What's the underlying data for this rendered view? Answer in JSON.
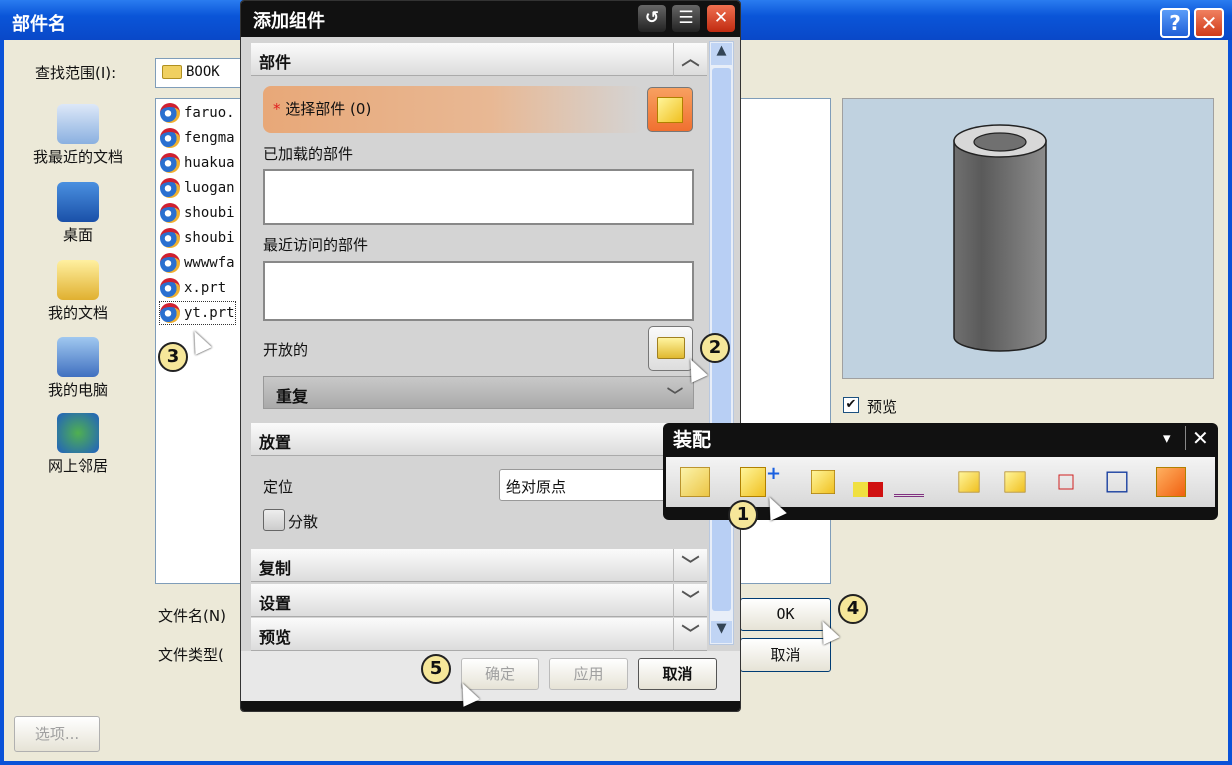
{
  "file_dialog": {
    "title": "部件名",
    "help_label": "?",
    "close_label": "✕",
    "look_in_label": "查找范围(I):",
    "look_in_value": "BOOK",
    "places": [
      {
        "label": "我最近的文档",
        "icon": "recent-documents-icon"
      },
      {
        "label": "桌面",
        "icon": "desktop-icon"
      },
      {
        "label": "我的文档",
        "icon": "my-documents-icon"
      },
      {
        "label": "我的电脑",
        "icon": "my-computer-icon"
      },
      {
        "label": "网上邻居",
        "icon": "network-icon"
      }
    ],
    "files": [
      "faruo.",
      "fengma",
      "huakua",
      "luogan",
      "shoubi",
      "shoubi",
      "wwwwfa",
      "x.prt",
      "yt.prt"
    ],
    "preview_checkbox_label": "预览",
    "preview_checked": true,
    "filename_label": "文件名(N)",
    "filetype_label": "文件类型(",
    "ok_label": "OK",
    "cancel_label": "取消",
    "options_label": "选项..."
  },
  "add_component": {
    "title": "添加组件",
    "reset_icon": "↺",
    "menu_icon": "☰",
    "close_icon": "✕",
    "sections": {
      "part": "部件",
      "placement": "放置",
      "copy": "复制",
      "settings": "设置",
      "preview": "预览"
    },
    "select_part": "选择部件 (0)",
    "required_mark": "*",
    "loaded_parts": "已加载的部件",
    "recent_parts": "最近访问的部件",
    "open_label": "开放的",
    "repeat_label": "重复",
    "position_label": "定位",
    "position_value": "绝对原点",
    "scatter_label": "分散",
    "scatter_checked": false,
    "ok_label": "确定",
    "apply_label": "应用",
    "cancel_label": "取消"
  },
  "assembly_toolbar": {
    "title": "装配",
    "dropdown": "▾",
    "close": "✕"
  },
  "callouts": [
    "1",
    "2",
    "3",
    "4",
    "5"
  ]
}
